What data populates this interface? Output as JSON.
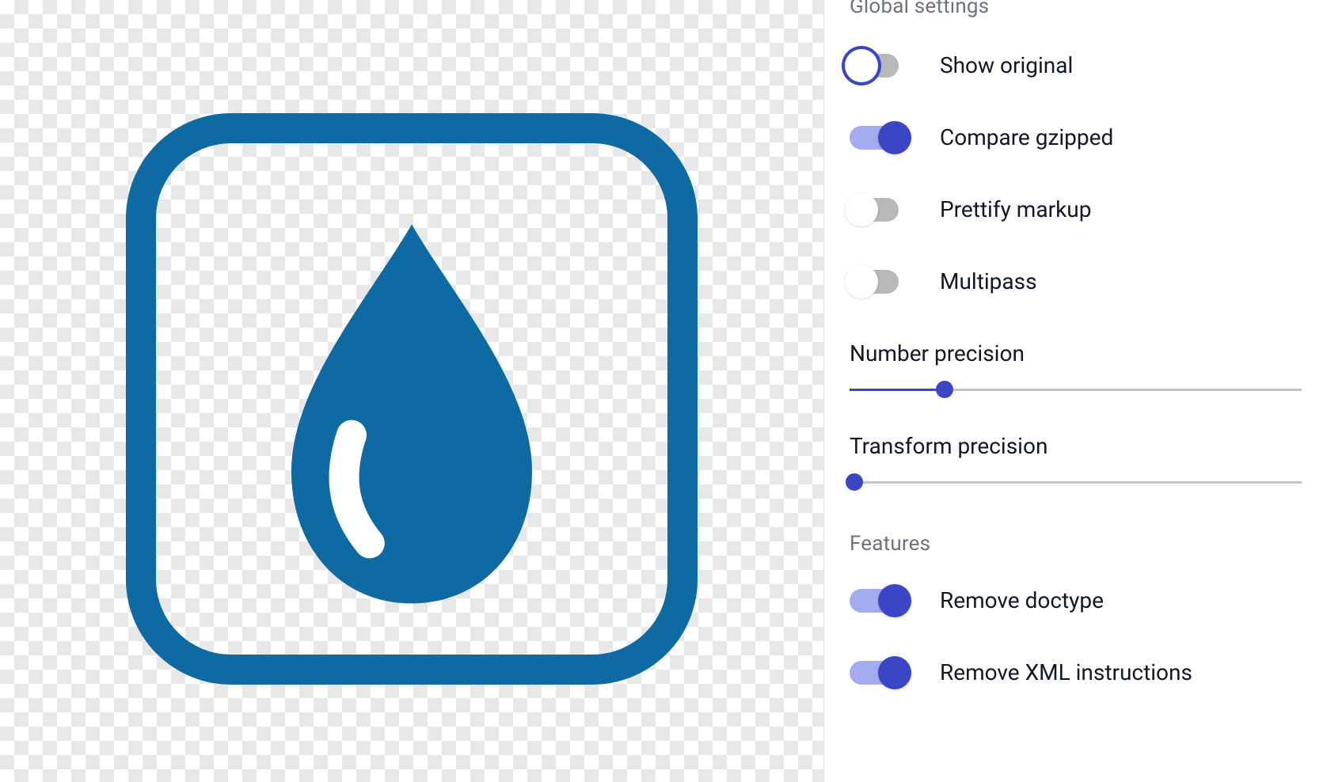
{
  "colors": {
    "iconBlue": "#0e6aa3",
    "accent": "#3b46c7",
    "accentLight": "#a4acef",
    "trackGray": "#b8b8b8"
  },
  "sections": {
    "global": "Global settings",
    "features": "Features"
  },
  "global": {
    "showOriginal": {
      "label": "Show original",
      "checked": false,
      "focused": true
    },
    "compareGzipped": {
      "label": "Compare gzipped",
      "checked": true
    },
    "prettifyMarkup": {
      "label": "Prettify markup",
      "checked": false
    },
    "multipass": {
      "label": "Multipass",
      "checked": false
    },
    "numberPrecision": {
      "label": "Number precision",
      "value": 21
    },
    "transformPrecision": {
      "label": "Transform precision",
      "value": 0
    }
  },
  "features": {
    "removeDoctype": {
      "label": "Remove doctype",
      "checked": true
    },
    "removeXmlInstructions": {
      "label": "Remove XML instructions",
      "checked": true
    }
  }
}
